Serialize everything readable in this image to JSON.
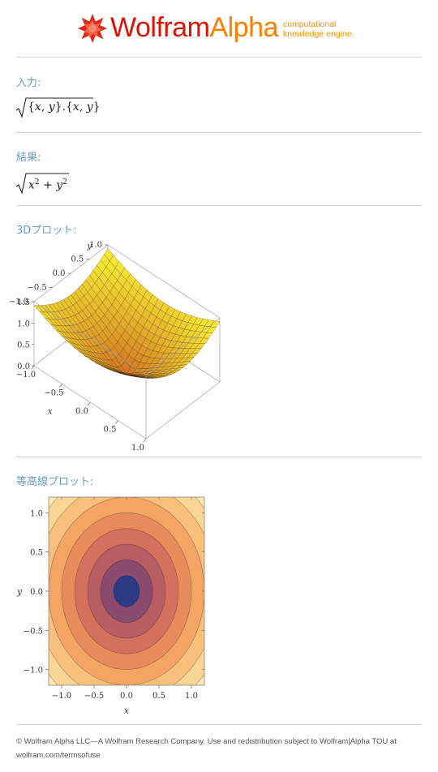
{
  "header": {
    "brand_wolfram": "Wolfram",
    "brand_alpha": "Alpha",
    "tagline_1": "computational",
    "tagline_2": "knowledge engine.",
    "logo_icon": "wolfram-spikey-icon"
  },
  "pods": {
    "input": {
      "title": "入力:",
      "expr_open": "{",
      "x1": "x",
      "comma1": ",",
      "y1": "y",
      "mid": "}.{",
      "x2": "x",
      "comma2": ",",
      "y2": "y",
      "expr_close": "}"
    },
    "result": {
      "title": "結果:",
      "x": "x",
      "x_exp": "2",
      "plus": "+",
      "y": "y",
      "y_exp": "2"
    },
    "plot3d": {
      "title": "3Dプロット:"
    },
    "contour": {
      "title": "等高線プロット:"
    }
  },
  "chart_data": [
    {
      "type": "surface3d",
      "function": "sqrt(x^2 + y^2)",
      "x_range": [
        -1,
        1
      ],
      "y_range": [
        -1,
        1
      ],
      "z_range": [
        0,
        1.5
      ],
      "x_ticks": [
        "−1.0",
        "−0.5",
        "0.0",
        "0.5",
        "1.0"
      ],
      "y_ticks": [
        "−1.0",
        "−0.5",
        "0.0",
        "0.5",
        "1.0"
      ],
      "z_ticks": [
        "0.0",
        "0.5",
        "1.0",
        "1.5"
      ],
      "xlabel": "x",
      "ylabel": "y",
      "colors": {
        "high": "#f5e632",
        "low": "#c6541e"
      }
    },
    {
      "type": "contour",
      "function": "sqrt(x^2 + y^2)",
      "x_range": [
        -1.2,
        1.2
      ],
      "y_range": [
        -1.2,
        1.2
      ],
      "x_ticks": [
        "−1.0",
        "−0.5",
        "0.0",
        "0.5",
        "1.0"
      ],
      "y_ticks": [
        "−1.0",
        "−0.5",
        "0.0",
        "0.5",
        "1.0"
      ],
      "xlabel": "x",
      "ylabel": "y",
      "levels": [
        0.2,
        0.4,
        0.6,
        0.8,
        1.0,
        1.2,
        1.4,
        1.6
      ],
      "fill_colors": [
        "#2d3b85",
        "#8a4b6e",
        "#b85d62",
        "#d4705e",
        "#e88c5c",
        "#f4a564",
        "#f8c07a",
        "#fbd594",
        "#fde8b4"
      ]
    }
  ],
  "footer": {
    "line1": "© Wolfram Alpha LLC—A Wolfram Research Company. Use and redistribution subject to Wolfram|Alpha TOU at",
    "line2": "wolfram.com/termsofuse"
  }
}
